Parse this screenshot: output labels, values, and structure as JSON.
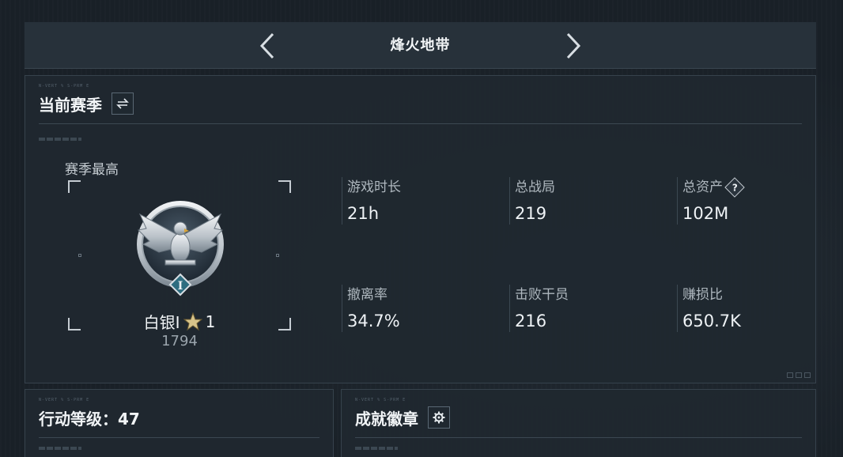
{
  "nav": {
    "title": "烽火地带",
    "prev_icon": "chevron-left-icon",
    "next_icon": "chevron-right-icon"
  },
  "season": {
    "micro_text": "N-VERT % S-PRM E",
    "title": "当前赛季",
    "switch_icon": "swap-icon",
    "best_label": "赛季最高",
    "rank": {
      "name": "白银I",
      "stars": "1",
      "score": "1794",
      "emblem_icon": "eagle-rank-emblem-icon",
      "emblem_numeral": "I"
    },
    "stats": [
      {
        "label": "游戏时长",
        "value": "21h"
      },
      {
        "label": "总战局",
        "value": "219"
      },
      {
        "label": "总资产",
        "value": "102M",
        "help": "?"
      },
      {
        "label": "撤离率",
        "value": "34.7%"
      },
      {
        "label": "击败干员",
        "value": "216"
      },
      {
        "label": "赚损比",
        "value": "650.7K"
      }
    ]
  },
  "level": {
    "micro_text": "N-VERT % S-PRM E",
    "title": "行动等级：47"
  },
  "badges": {
    "micro_text": "N-VERT % S-PRM E",
    "title": "成就徽章",
    "settings_icon": "gear-icon"
  },
  "colors": {
    "background": "#1a2128",
    "panel": "#1f2830",
    "text": "#f1f4f6",
    "muted": "#aeb7be",
    "border": "#36424c"
  }
}
